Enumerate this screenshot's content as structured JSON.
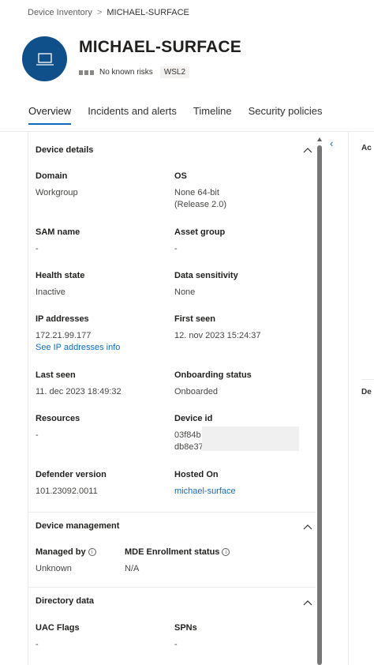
{
  "breadcrumb": {
    "root": "Device Inventory",
    "separator": ">",
    "current": "MICHAEL-SURFACE"
  },
  "device": {
    "name": "MICHAEL-SURFACE",
    "risk_text": "No known risks",
    "tag": "WSL2",
    "avatar_icon": "laptop-icon"
  },
  "tabs": [
    {
      "label": "Overview",
      "active": true
    },
    {
      "label": "Incidents and alerts",
      "active": false
    },
    {
      "label": "Timeline",
      "active": false
    },
    {
      "label": "Security policies",
      "active": false
    }
  ],
  "right_panel": {
    "label_top": "Ac",
    "label_bottom": "De"
  },
  "sections": {
    "device_details": {
      "title": "Device details",
      "fields": {
        "domain": {
          "label": "Domain",
          "value": "Workgroup"
        },
        "os": {
          "label": "OS",
          "value": "None 64-bit",
          "value2": "(Release 2.0)"
        },
        "sam_name": {
          "label": "SAM name",
          "value": "-"
        },
        "asset_group": {
          "label": "Asset group",
          "value": "-"
        },
        "health_state": {
          "label": "Health state",
          "value": "Inactive"
        },
        "data_sensitivity": {
          "label": "Data sensitivity",
          "value": "None"
        },
        "ip_addresses": {
          "label": "IP addresses",
          "value": "172.21.99.177",
          "link": "See IP addresses info"
        },
        "first_seen": {
          "label": "First seen",
          "value": "12. nov 2023 15:24:37"
        },
        "last_seen": {
          "label": "Last seen",
          "value": "11. dec 2023 18:49:32"
        },
        "onboarding_status": {
          "label": "Onboarding status",
          "value": "Onboarded"
        },
        "resources": {
          "label": "Resources",
          "value": "-"
        },
        "device_id": {
          "label": "Device id",
          "value": "03f84b",
          "value2": "db8e37"
        },
        "defender_version": {
          "label": "Defender version",
          "value": "101.23092.0011"
        },
        "hosted_on": {
          "label": "Hosted On",
          "link": "michael-surface"
        }
      }
    },
    "device_management": {
      "title": "Device management",
      "fields": {
        "managed_by": {
          "label": "Managed by",
          "value": "Unknown"
        },
        "mde_enrollment": {
          "label": "MDE Enrollment status",
          "value": "N/A"
        }
      }
    },
    "directory_data": {
      "title": "Directory data",
      "fields": {
        "uac_flags": {
          "label": "UAC Flags",
          "value": "-"
        },
        "spns": {
          "label": "SPNs",
          "value": "-"
        }
      }
    }
  },
  "colors": {
    "accent": "#0f6cbd",
    "avatar_bg": "#0f4f8a"
  }
}
